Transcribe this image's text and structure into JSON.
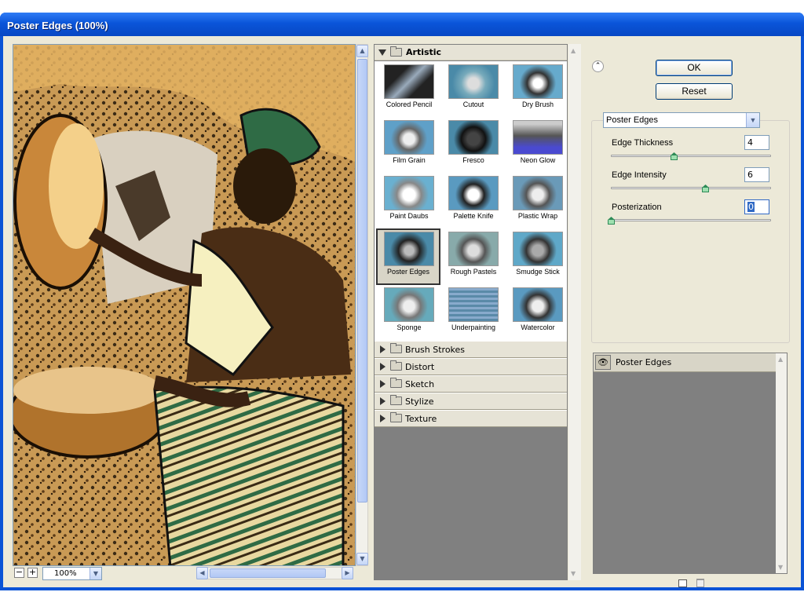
{
  "window": {
    "title": "Poster Edges (100%)"
  },
  "preview": {
    "zoom": "100%"
  },
  "gallery": {
    "open_category": "Artistic",
    "filters": [
      {
        "label": "Colored Pencil",
        "icon": "colored-pencil-thumbnail"
      },
      {
        "label": "Cutout",
        "icon": "cutout-thumbnail"
      },
      {
        "label": "Dry Brush",
        "icon": "dry-brush-thumbnail"
      },
      {
        "label": "Film Grain",
        "icon": "film-grain-thumbnail"
      },
      {
        "label": "Fresco",
        "icon": "fresco-thumbnail"
      },
      {
        "label": "Neon Glow",
        "icon": "neon-glow-thumbnail"
      },
      {
        "label": "Paint Daubs",
        "icon": "paint-daubs-thumbnail"
      },
      {
        "label": "Palette Knife",
        "icon": "palette-knife-thumbnail"
      },
      {
        "label": "Plastic Wrap",
        "icon": "plastic-wrap-thumbnail"
      },
      {
        "label": "Poster Edges",
        "icon": "poster-edges-thumbnail"
      },
      {
        "label": "Rough Pastels",
        "icon": "rough-pastels-thumbnail"
      },
      {
        "label": "Smudge Stick",
        "icon": "smudge-stick-thumbnail"
      },
      {
        "label": "Sponge",
        "icon": "sponge-thumbnail"
      },
      {
        "label": "Underpainting",
        "icon": "underpainting-thumbnail"
      },
      {
        "label": "Watercolor",
        "icon": "watercolor-thumbnail"
      }
    ],
    "selected": "Poster Edges",
    "collapsed_categories": [
      "Brush Strokes",
      "Distort",
      "Sketch",
      "Stylize",
      "Texture"
    ]
  },
  "buttons": {
    "ok": "OK",
    "reset": "Reset"
  },
  "settings": {
    "filter": "Poster Edges",
    "params": [
      {
        "label": "Edge Thickness",
        "value": "4",
        "level": 0.4
      },
      {
        "label": "Edge Intensity",
        "value": "6",
        "level": 0.6
      },
      {
        "label": "Posterization",
        "value": "0",
        "level": 0.0
      }
    ]
  },
  "layers": {
    "items": [
      {
        "label": "Poster Edges"
      }
    ]
  }
}
